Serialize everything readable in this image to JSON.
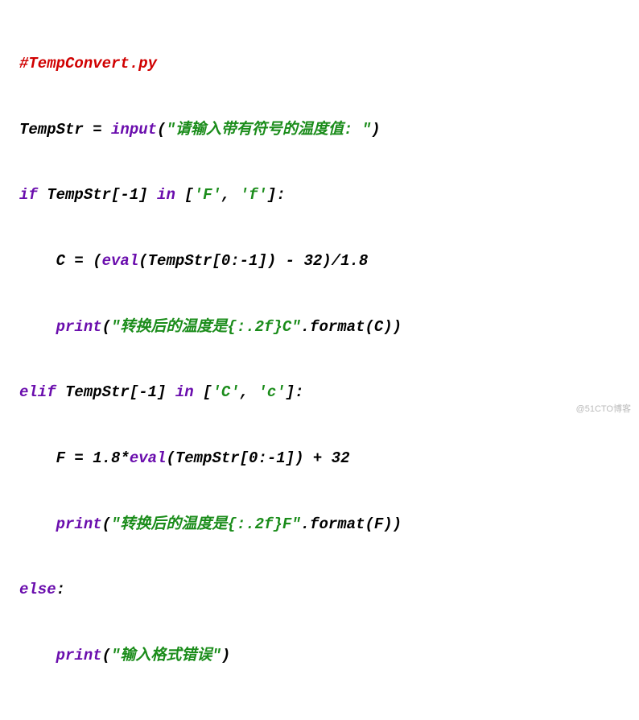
{
  "code": {
    "line1_comment": "#TempConvert.py",
    "line2_a": "TempStr = ",
    "line2_b": "input",
    "line2_c": "(",
    "line2_d": "\"请输入带有符号的温度值: \"",
    "line2_e": ")",
    "line3_a": "if",
    "line3_b": " TempStr[-1] ",
    "line3_c": "in",
    "line3_d": " [",
    "line3_e": "'F'",
    "line3_f": ", ",
    "line3_g": "'f'",
    "line3_h": "]:",
    "line4_a": "    C = (",
    "line4_b": "eval",
    "line4_c": "(TempStr[0:-1]) - 32)/1.8",
    "line5_a": "    ",
    "line5_b": "print",
    "line5_c": "(",
    "line5_d": "\"转换后的温度是{:.2f}C\"",
    "line5_e": ".format(C))",
    "line6_a": "elif",
    "line6_b": " TempStr[-1] ",
    "line6_c": "in",
    "line6_d": " [",
    "line6_e": "'C'",
    "line6_f": ", ",
    "line6_g": "'c'",
    "line6_h": "]:",
    "line7_a": "    F = 1.8*",
    "line7_b": "eval",
    "line7_c": "(TempStr[0:-1]) + 32",
    "line8_a": "    ",
    "line8_b": "print",
    "line8_c": "(",
    "line8_d": "\"转换后的温度是{:.2f}F\"",
    "line8_e": ".format(F))",
    "line9_a": "else",
    "line9_b": ":",
    "line10_a": "    ",
    "line10_b": "print",
    "line10_c": "(",
    "line10_d": "\"输入格式错误\"",
    "line10_e": ")"
  },
  "watermark": "@51CTO博客"
}
